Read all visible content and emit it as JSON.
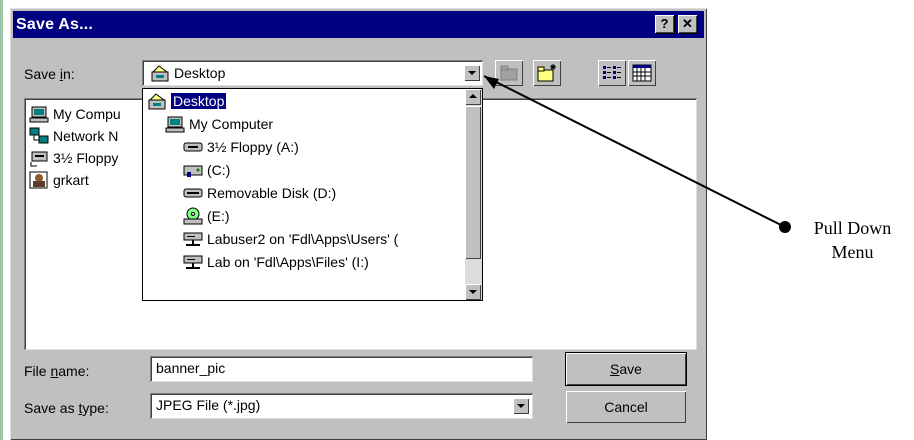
{
  "dialog": {
    "title": "Save As...",
    "help_label": "?",
    "close_label": "✕"
  },
  "save_in": {
    "label_prefix": "Save ",
    "label_underlined": "i",
    "label_suffix": "n:",
    "value": "Desktop"
  },
  "file_list": [
    {
      "name": "My Compu",
      "icon": "computer-icon"
    },
    {
      "name": "Network N",
      "icon": "network-icon"
    },
    {
      "name": "3½ Floppy",
      "icon": "floppy-icon"
    },
    {
      "name": "grkart",
      "icon": "image-icon"
    }
  ],
  "dropdown_items": [
    {
      "label": "Desktop",
      "icon": "desktop-icon",
      "selected": true
    },
    {
      "label": "My Computer",
      "icon": "computer-icon"
    },
    {
      "label": "3½ Floppy (A:)",
      "icon": "floppy-drive-icon"
    },
    {
      "label": "(C:)",
      "icon": "hard-drive-icon"
    },
    {
      "label": "Removable Disk (D:)",
      "icon": "removable-disk-icon"
    },
    {
      "label": "(E:)",
      "icon": "cd-drive-icon"
    },
    {
      "label": "Labuser2 on 'Fdl\\Apps\\Users' (",
      "icon": "network-drive-icon"
    },
    {
      "label": "Lab on 'Fdl\\Apps\\Files' (I:)",
      "icon": "network-drive-icon"
    }
  ],
  "file_name": {
    "label_prefix": "File ",
    "label_underlined": "n",
    "label_suffix": "ame:",
    "value": "banner_pic"
  },
  "save_as_type": {
    "label_prefix": "Save as ",
    "label_underlined": "t",
    "label_suffix": "ype:",
    "value": "JPEG File (*.jpg)"
  },
  "buttons": {
    "save_underlined": "S",
    "save_rest": "ave",
    "cancel": "Cancel"
  },
  "annotation": {
    "line1": "Pull Down",
    "line2": "Menu"
  }
}
